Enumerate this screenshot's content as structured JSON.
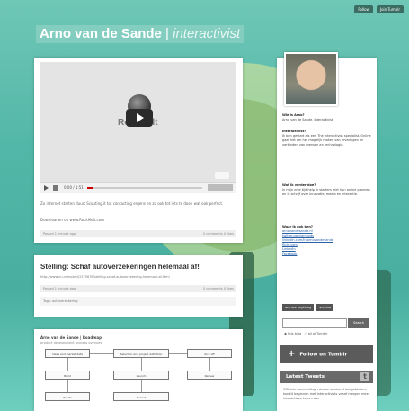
{
  "header": {
    "title": "Arno van de Sande",
    "separator": "|",
    "subtitle": "interactivist",
    "top_actions": [
      "Follow",
      "Join Tumblr"
    ]
  },
  "posts": [
    {
      "type": "video",
      "video_brand": "RockMelt",
      "player_time": "0:00 / 1:51",
      "excerpt": "Zo internet starten duurt Scouting.it tot contacting ergens en zo ook tot iets te doen wat ook perfect.",
      "link_text": "Downloaden op www.RockMelt.com",
      "meta_left": "Posted 1 minute ago",
      "meta_right": "0 comments   0 likes"
    },
    {
      "type": "link",
      "title": "Stelling: Schaf autoverzekeringen helemaal af!",
      "url": "http://www.nu.nl/mobiel/2375678/stelling-schaf-autoverzekering-helemaal-af.html",
      "meta_left": "Posted 1 minute ago",
      "meta_right": "0 comments   0 likes",
      "tags": "Tags: autoverzekering"
    },
    {
      "type": "diagram",
      "title": "Arno van de Sande | Roadmap",
      "subtitle": "product development process overview",
      "nodes": [
        "Ideas and market data",
        "Selection and project definition",
        "Kick-off",
        "Build",
        "Launch",
        "Review",
        "Iterate",
        "Sunset"
      ]
    }
  ],
  "sidebar": {
    "who_heading": "Wie is Arno?",
    "who_text": "Arno van de Sande, interactivist.",
    "interactivist_heading": "Interactivist?",
    "interactivist_text": "Ik ben gestart als een The Interactivist specialist. Online gaat het om het mogelijk maken van ervaringen en verbinden van mensen en technologie.",
    "work_heading": "Wat ik verder doe?",
    "work_text": "In mijn vrije tijd help ik starters met hun online plannen en ik schrijf over innovatie, media en interactie.",
    "contact_heading": "Waar ik ook ben?",
    "links": [
      "arnovandesande.nl",
      "twitter.com/arnovds",
      "linkedin.com/in/arnovandesande",
      "flickr.com",
      "LinkedIn",
      "Facebook"
    ],
    "buttons": [
      "ask me anything",
      "archive"
    ],
    "search_button": "Search",
    "radio_options": [
      "this blog",
      "all of Tumblr"
    ],
    "follow_label": "Follow on Tumblr",
    "tweets_heading": "Latest Tweets",
    "tweets_text": "Officiele aanmelding: nieuwe weekend leergebieden, toolkit beginnen met Interactivists vanaf morgen meer interactieve Lees meer"
  }
}
